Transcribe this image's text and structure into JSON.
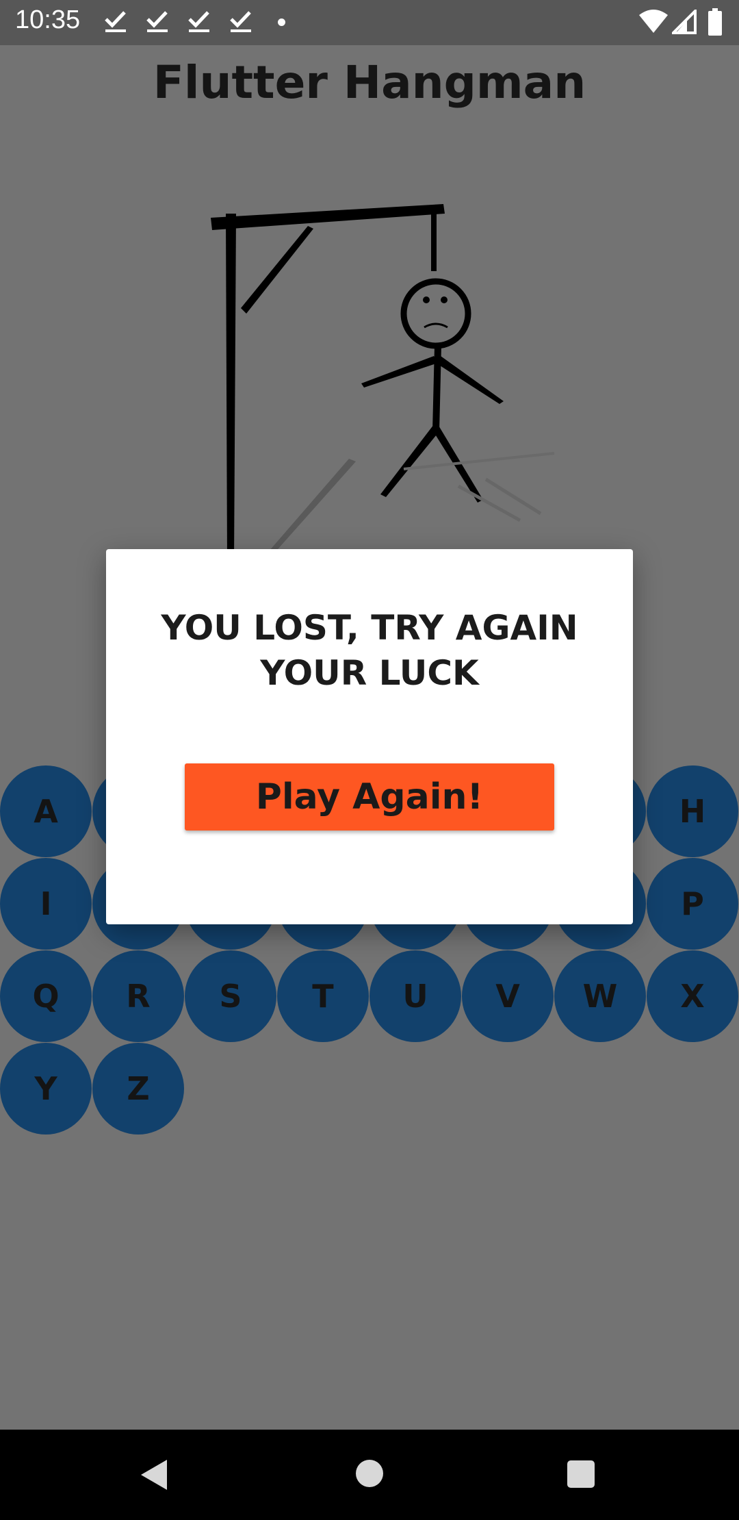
{
  "status_bar": {
    "time": "10:35",
    "icons": [
      "check-notification-icon",
      "check-notification-icon",
      "check-notification-icon",
      "check-notification-icon",
      "dot-icon",
      "wifi-icon",
      "signal-icon",
      "battery-icon"
    ]
  },
  "app": {
    "title": "Flutter Hangman"
  },
  "keyboard": {
    "row1": [
      "A",
      "H"
    ],
    "row2": [
      "I",
      "P"
    ],
    "row3": [
      "Q",
      "R",
      "S",
      "T",
      "U",
      "V",
      "W",
      "X"
    ],
    "row4": [
      "Y",
      "Z"
    ]
  },
  "dialog": {
    "message_line1": "YOU LOST, TRY AGAIN",
    "message_line2": "YOUR LUCK",
    "button_label": "Play Again!"
  },
  "colors": {
    "scrim": "#737373",
    "key_background": "#12416c",
    "button_accent": "#fe5722"
  },
  "nav_bar": {
    "icons": [
      "back-icon",
      "home-icon",
      "recents-icon"
    ]
  }
}
